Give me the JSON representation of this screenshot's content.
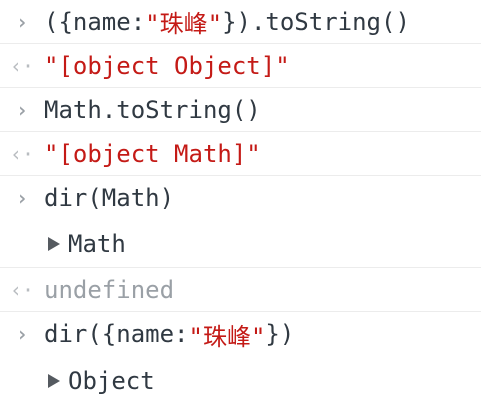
{
  "console": {
    "lines": [
      {
        "kind": "input",
        "pre": "({name:",
        "str": "\"珠峰\"",
        "post": "}).toString()"
      },
      {
        "kind": "output",
        "str": "\"[object Object]\""
      },
      {
        "kind": "input",
        "text": "Math.toString()"
      },
      {
        "kind": "output",
        "str": "\"[object Math]\""
      },
      {
        "kind": "input",
        "text": "dir(Math)"
      },
      {
        "kind": "tree",
        "label": "Math"
      },
      {
        "kind": "output-muted",
        "text": "undefined"
      },
      {
        "kind": "input",
        "pre": "dir({name:",
        "str": "\"珠峰\"",
        "post": "})"
      },
      {
        "kind": "tree",
        "label": "Object"
      }
    ],
    "prompt_input": "›",
    "prompt_output": "‹·"
  }
}
